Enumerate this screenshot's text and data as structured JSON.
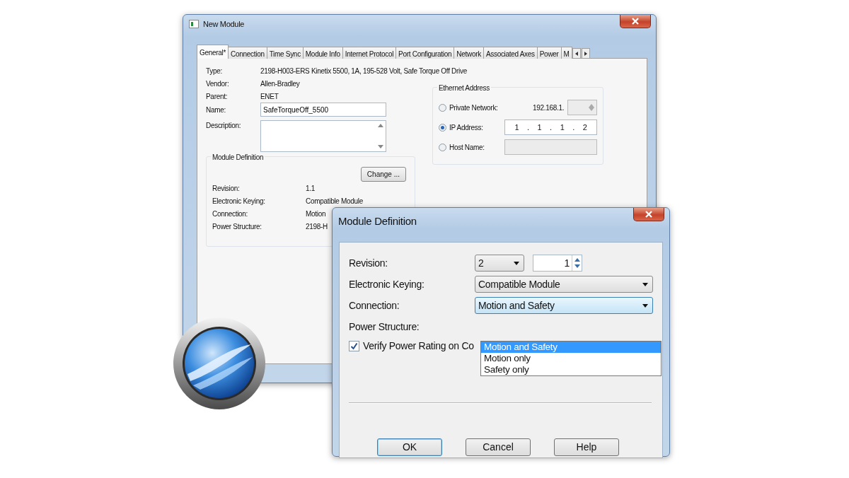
{
  "main_window": {
    "title": "New Module",
    "tabs": [
      {
        "label": "General*",
        "selected": true
      },
      {
        "label": "Connection",
        "selected": false
      },
      {
        "label": "Time Sync",
        "selected": false
      },
      {
        "label": "Module Info",
        "selected": false
      },
      {
        "label": "Internet Protocol",
        "selected": false
      },
      {
        "label": "Port Configuration",
        "selected": false
      },
      {
        "label": "Network",
        "selected": false
      },
      {
        "label": "Associated Axes",
        "selected": false
      },
      {
        "label": "Power",
        "selected": false
      },
      {
        "label": "M",
        "selected": false
      }
    ],
    "fields": [
      {
        "kind": "text",
        "label": "Type:",
        "value": "2198-H003-ERS Kinetix 5500, 1A, 195-528 Volt, Safe Torque Off Drive"
      },
      {
        "kind": "text",
        "label": "Vendor:",
        "value": "Allen-Bradley"
      },
      {
        "kind": "text",
        "label": "Parent:",
        "value": "ENET"
      },
      {
        "kind": "input",
        "label": "Name:",
        "value": "SafeTorqueOff_5500"
      },
      {
        "kind": "textarea",
        "label": "Description:"
      }
    ],
    "module_definition": {
      "title": "Module Definition",
      "button": "Change ...",
      "rows": [
        {
          "label": "Revision:",
          "value": "1.1"
        },
        {
          "label": "Electronic Keying:",
          "value": "Compatible Module"
        },
        {
          "label": "Connection:",
          "value": "Motion"
        },
        {
          "label": "Power Structure:",
          "value": "2198-H"
        }
      ]
    },
    "ethernet_address": {
      "title": "Ethernet Address",
      "options": [
        {
          "kind": "private",
          "label": "Private Network:",
          "selected": false,
          "prefix": "192.168.1."
        },
        {
          "kind": "ip",
          "label": "IP Address:",
          "selected": true,
          "value": "1 . 1 . 1 . 2"
        },
        {
          "kind": "host",
          "label": "Host Name:",
          "selected": false
        }
      ]
    }
  },
  "dialog": {
    "title": "Module Definition",
    "revision": {
      "label": "Revision:",
      "major": "2",
      "minor": "1"
    },
    "keying": {
      "label": "Electronic Keying:",
      "value": "Compatible Module"
    },
    "connection": {
      "label": "Connection:",
      "value": "Motion and Safety",
      "expanded": true,
      "options": [
        {
          "label": "Motion and Safety",
          "selected": true
        },
        {
          "label": "Motion only",
          "selected": false
        },
        {
          "label": "Safety only",
          "selected": false
        }
      ]
    },
    "power_structure": {
      "label": "Power Structure:"
    },
    "verify": {
      "label": "Verify Power Rating on Co",
      "checked": true
    },
    "buttons": [
      {
        "label": "OK",
        "default": true
      },
      {
        "label": "Cancel",
        "default": false
      },
      {
        "label": "Help",
        "default": false
      }
    ]
  }
}
